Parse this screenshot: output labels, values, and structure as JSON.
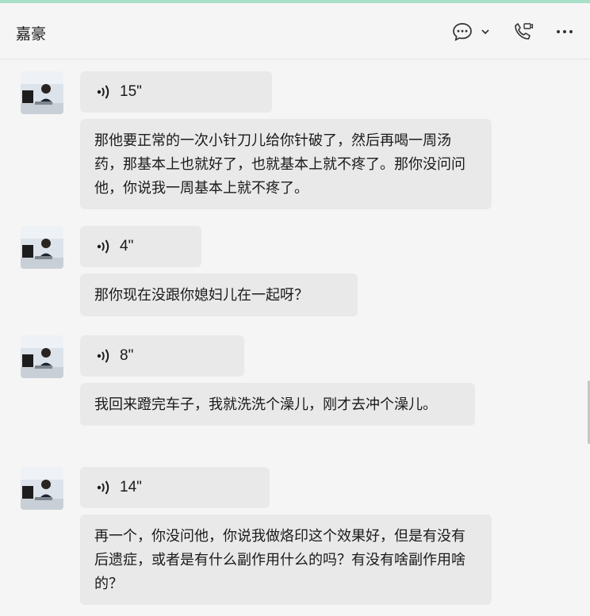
{
  "header": {
    "title": "嘉豪"
  },
  "messages": [
    {
      "voice_duration": "15\"",
      "text": "那他要正常的一次小针刀儿给你针破了，然后再喝一周汤药，那基本上也就好了，也就基本上就不疼了。那你没问问他，你说我一周基本上就不疼了。"
    },
    {
      "voice_duration": "4\"",
      "text": "那你现在没跟你媳妇儿在一起呀？"
    },
    {
      "voice_duration": "8\"",
      "text": "我回来蹬完车子，我就洗洗个澡儿，刚才去冲个澡儿。"
    },
    {
      "voice_duration": "14\"",
      "text": "再一个，你没问他，你说我做烙印这个效果好，但是有没有后遗症，或者是有什么副作用什么的吗？有没有啥副作用啥的？"
    }
  ],
  "icons": [
    "chat-bubble-icon",
    "chevron-down-icon",
    "video-call-icon",
    "more-icon",
    "voice-wave-icon",
    "avatar"
  ]
}
